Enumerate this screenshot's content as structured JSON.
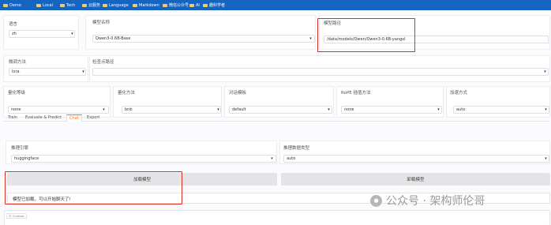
{
  "bookmarks": [
    {
      "icon": "folder-icon",
      "label": "Demo"
    },
    {
      "icon": "folder-icon",
      "label": "Local"
    },
    {
      "icon": "folder-icon",
      "label": "Tech"
    },
    {
      "icon": "folder-icon",
      "label": "云服务"
    },
    {
      "icon": "folder-icon",
      "label": "Language"
    },
    {
      "icon": "folder-icon",
      "label": "Markdown"
    },
    {
      "icon": "folder-icon",
      "label": "微信公众号"
    },
    {
      "icon": "folder-icon",
      "label": "AI"
    },
    {
      "icon": "folder-icon",
      "label": "趣科学者"
    }
  ],
  "top": {
    "language": {
      "label": "语言",
      "value": "zh"
    },
    "model_name": {
      "label": "模型名称",
      "info": "",
      "value": "Qwen3-0.6B-Base"
    },
    "model_path": {
      "label": "模型路径",
      "info": "",
      "value": "/data/models/Qwen/Qwen3-0.6B-yangxl"
    }
  },
  "row2": {
    "finetune": {
      "label": "微调方法",
      "value": "lora"
    },
    "checkpoint": {
      "label": "检查点路径",
      "value": ""
    }
  },
  "row3": {
    "quant_bit": {
      "label": "量化等级",
      "info": "",
      "value": "none"
    },
    "quant_method": {
      "label": "量化方法",
      "info": "",
      "value": "bnb"
    },
    "template": {
      "label": "对话模板",
      "info": "",
      "value": "default"
    },
    "rope": {
      "label": "RoPE 插值方法",
      "info": "",
      "value": "none"
    },
    "booster": {
      "label": "加速方式",
      "info": "",
      "value": "auto"
    }
  },
  "tabs": [
    "Train",
    "Evaluate & Predict",
    "Chat",
    "Export"
  ],
  "active_tab": "Chat",
  "chat": {
    "backend": {
      "label": "推理引擎",
      "value": "huggingface"
    },
    "dtype": {
      "label": "推理数据类型",
      "value": "auto"
    },
    "load_label": "加载模型",
    "unload_label": "卸载模型",
    "status": "模型已加载，可以开始聊天了!",
    "chatbot_label": "Chatbot"
  },
  "watermark": "公众号 · 架构师伦哥",
  "colors": {
    "bookmarks_bar": "#1565c0",
    "active_tab": "#f97316",
    "highlight_box": "#d93025"
  }
}
